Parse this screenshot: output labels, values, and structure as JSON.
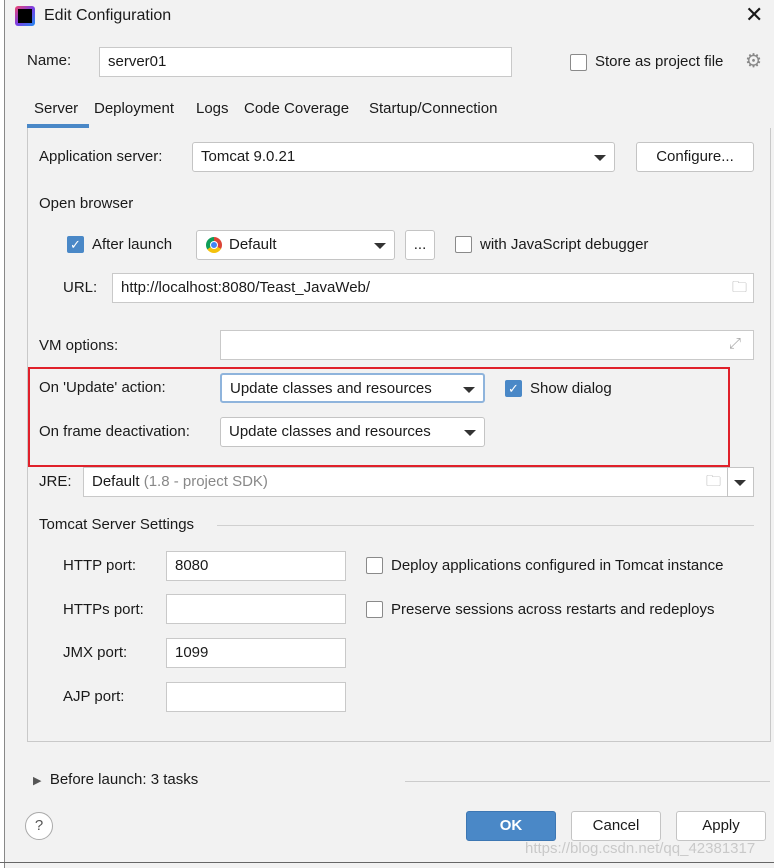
{
  "title": "Edit Configuration",
  "name": {
    "label": "Name:",
    "value": "server01"
  },
  "store_as_project": {
    "label": "Store as project file",
    "checked": false
  },
  "tabs": [
    {
      "label": "Server",
      "active": true
    },
    {
      "label": "Deployment"
    },
    {
      "label": "Logs"
    },
    {
      "label": "Code Coverage"
    },
    {
      "label": "Startup/Connection"
    }
  ],
  "server": {
    "app_server_label": "Application server:",
    "app_server_value": "Tomcat 9.0.21",
    "configure": "Configure...",
    "open_browser": "Open browser",
    "after_launch": "After launch",
    "after_launch_checked": true,
    "browser": "Default",
    "ellipsis": "...",
    "js_debugger": "with JavaScript debugger",
    "js_debugger_checked": false,
    "url_label": "URL:",
    "url": "http://localhost:8080/Teast_JavaWeb/",
    "vm_label": "VM options:",
    "vm_value": "",
    "update_label": "On 'Update' action:",
    "update_value": "Update classes and resources",
    "show_dialog": "Show dialog",
    "show_dialog_checked": true,
    "frame_label": "On frame deactivation:",
    "frame_value": "Update classes and resources",
    "jre_label": "JRE:",
    "jre_value": "Default",
    "jre_hint": "(1.8 - project SDK)",
    "tomcat_settings": "Tomcat Server Settings",
    "http_label": "HTTP port:",
    "http": "8080",
    "https_label": "HTTPs port:",
    "https": "",
    "jmx_label": "JMX port:",
    "jmx": "1099",
    "ajp_label": "AJP port:",
    "ajp": "",
    "deploy_apps": "Deploy applications configured in Tomcat instance",
    "deploy_checked": false,
    "preserve": "Preserve sessions across restarts and redeploys",
    "preserve_checked": false
  },
  "before_launch": "Before launch: 3 tasks",
  "buttons": {
    "help": "?",
    "ok": "OK",
    "cancel": "Cancel",
    "apply": "Apply"
  },
  "watermark": "https://blog.csdn.net/qq_42381317",
  "colors": {
    "accent": "#4a88c7",
    "highlight": "#e0202a"
  }
}
